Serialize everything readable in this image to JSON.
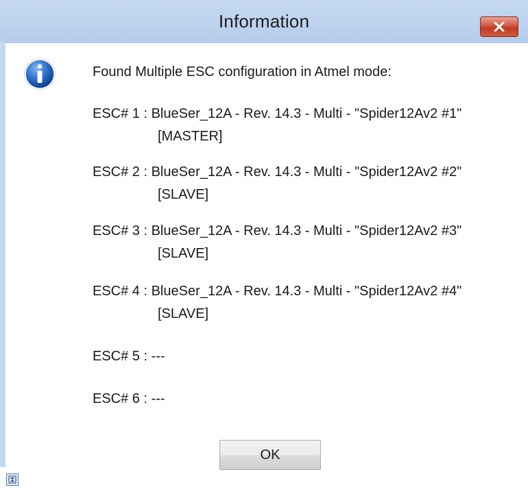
{
  "dialog": {
    "title": "Information",
    "heading": "Found Multiple ESC configuration in Atmel mode:",
    "esc_lines": [
      {
        "main": "ESC# 1 : BlueSer_12A - Rev. 14.3 - Multi - \"Spider12Av2 #1\"",
        "role": "[MASTER]"
      },
      {
        "main": "ESC# 2 : BlueSer_12A - Rev. 14.3 - Multi - \"Spider12Av2 #2\"",
        "role": "[SLAVE]"
      },
      {
        "main": "ESC# 3 : BlueSer_12A - Rev. 14.3 - Multi - \"Spider12Av2 #3\"",
        "role": "[SLAVE]"
      },
      {
        "main": "ESC# 4 : BlueSer_12A - Rev. 14.3 - Multi - \"Spider12Av2 #4\"",
        "role": "[SLAVE]"
      },
      {
        "main": "ESC# 5 :  ---"
      },
      {
        "main": "ESC# 6 :  ---"
      }
    ],
    "ok_label": "OK",
    "icons": {
      "info": "information-icon",
      "close": "close-icon",
      "corner": "hourglass-icon"
    },
    "colors": {
      "titlebar": "#c6d9f1",
      "close_button": "#c94a33",
      "icon_blue": "#1f5fb4"
    }
  }
}
